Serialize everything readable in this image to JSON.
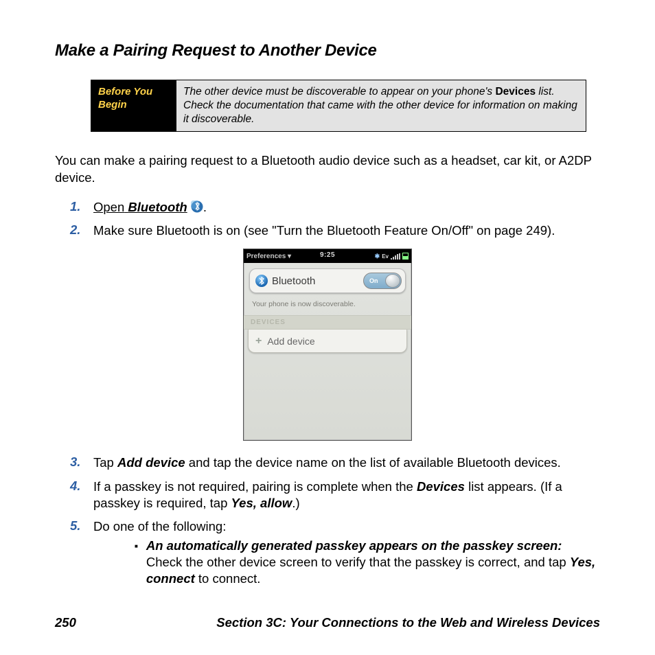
{
  "title": "Make a Pairing Request to Another Device",
  "callout": {
    "label": "Before You Begin",
    "text_a": "The other device must be discoverable to appear on your phone's ",
    "text_b": "Devices",
    "text_c": " list. Check the documentation that came with the other device for information on making it discoverable."
  },
  "intro": "You can make a pairing request to a Bluetooth audio device such as a headset, car kit, or A2DP device.",
  "steps": {
    "s1": {
      "num": "1.",
      "a": "Open",
      "b": "Bluetooth",
      "c": "."
    },
    "s2": {
      "num": "2.",
      "text": "Make sure Bluetooth is on (see \"Turn the Bluetooth Feature On/Off\" on page 249)."
    },
    "s3": {
      "num": "3.",
      "a": "Tap ",
      "b": "Add device",
      "c": " and tap the device name on the list of available Bluetooth devices."
    },
    "s4": {
      "num": "4.",
      "a": "If a passkey is not required, pairing is complete when the ",
      "b": "Devices",
      "c": " list appears. (If a passkey is required, tap ",
      "d": "Yes, allow",
      "e": ".)"
    },
    "s5": {
      "num": "5.",
      "text": "Do one of the following:"
    }
  },
  "bullet1": {
    "lead": "An automatically generated passkey appears on the passkey screen:",
    "rest_a": " Check the other device screen to verify that the passkey is correct, and tap ",
    "rest_b": "Yes, connect",
    "rest_c": " to connect."
  },
  "phone": {
    "menu": "Preferences",
    "time": "9:25",
    "bt_label": "Bluetooth",
    "toggle": "On",
    "discoverable": "Your phone is now discoverable.",
    "devices_header": "DEVICES",
    "add_device": "Add device"
  },
  "footer": {
    "page": "250",
    "section": "Section 3C: Your Connections to the Web and Wireless Devices"
  }
}
